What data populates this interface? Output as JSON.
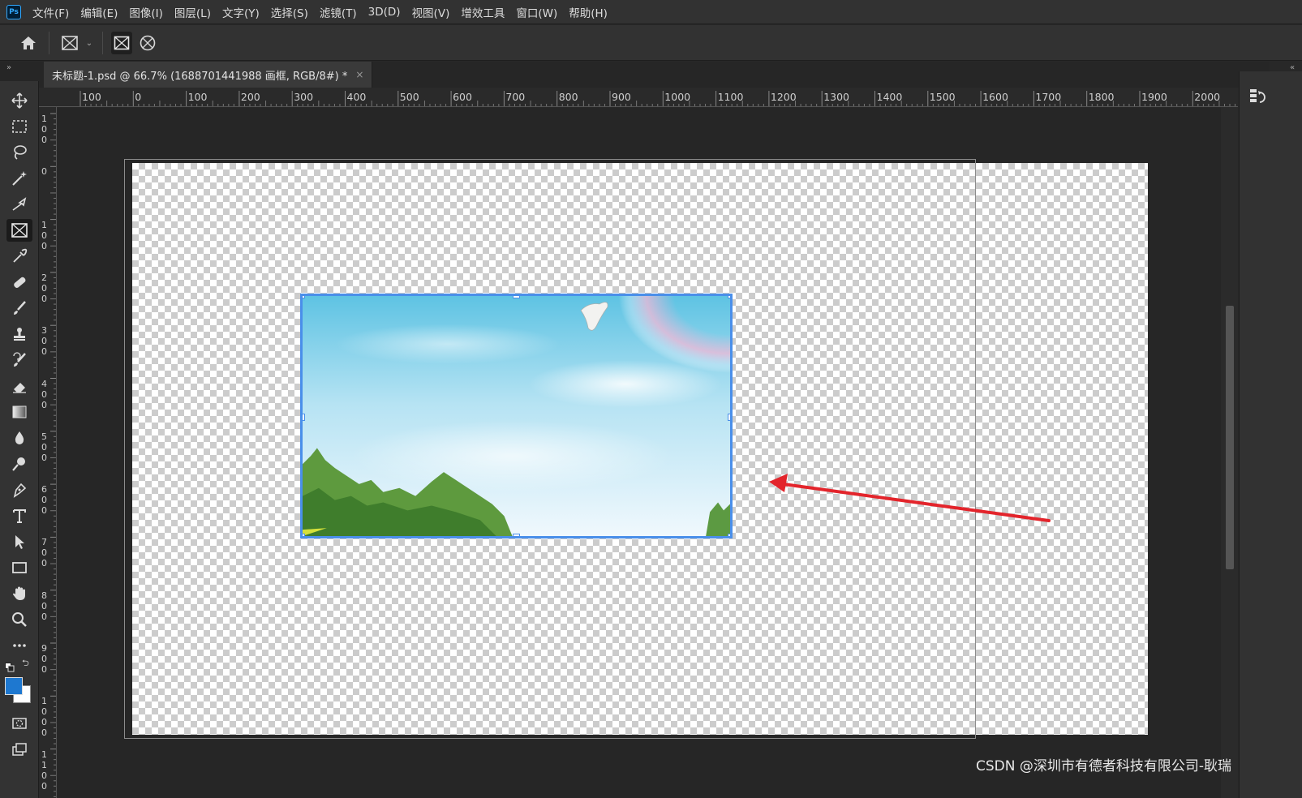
{
  "app": {
    "logo_text": "Ps"
  },
  "menu": {
    "items": [
      "文件(F)",
      "编辑(E)",
      "图像(I)",
      "图层(L)",
      "文字(Y)",
      "选择(S)",
      "滤镜(T)",
      "3D(D)",
      "视图(V)",
      "增效工具",
      "窗口(W)",
      "帮助(H)"
    ]
  },
  "options_bar": {
    "home_icon": "home-icon",
    "frame_tool_icon": "frame-tool-icon",
    "rect_frame_icon": "rectangle-frame-icon",
    "ellipse_frame_icon": "ellipse-frame-icon"
  },
  "document": {
    "tab_title": "未标题-1.psd @ 66.7% (1688701441988 画框, RGB/8#) *",
    "close_glyph": "×"
  },
  "ruler": {
    "horizontal": [
      "100",
      "0",
      "100",
      "200",
      "300",
      "400",
      "500",
      "600",
      "700",
      "800",
      "900",
      "1000",
      "1100",
      "1200",
      "1300",
      "1400",
      "1500",
      "1600",
      "1700",
      "1800",
      "1900",
      "2000"
    ],
    "vertical": [
      "100",
      "0",
      "100",
      "200",
      "300",
      "400",
      "500",
      "600",
      "700",
      "800",
      "900",
      "1000",
      "1100"
    ]
  },
  "toolbar": {
    "tools": [
      "move-tool-icon",
      "marquee-tool-icon",
      "lasso-tool-icon",
      "magic-wand-tool-icon",
      "object-select-tool-icon",
      "frame-tool-icon",
      "eyedropper-tool-icon",
      "healing-brush-tool-icon",
      "brush-tool-icon",
      "clone-stamp-tool-icon",
      "history-brush-tool-icon",
      "eraser-tool-icon",
      "gradient-tool-icon",
      "blur-tool-icon",
      "dodge-tool-icon",
      "pen-tool-icon",
      "type-tool-icon",
      "path-select-tool-icon",
      "rectangle-tool-icon",
      "hand-tool-icon",
      "zoom-tool-icon",
      "more-tools-icon"
    ],
    "foreground_color": "#1e78d0",
    "background_color": "#ffffff",
    "active_tool": "frame-tool-icon"
  },
  "colors": {
    "frame_border": "#4a8fea",
    "arrow": "#e3242b"
  },
  "watermark": "CSDN @深圳市有德者科技有限公司-耿瑞"
}
